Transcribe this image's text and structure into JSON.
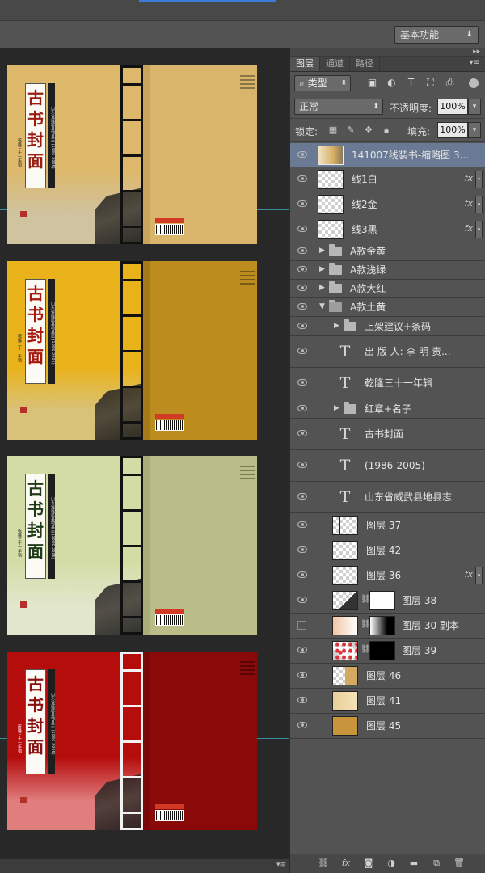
{
  "optionsbar": {
    "workspace": "基本功能"
  },
  "panel": {
    "tabs": [
      "图层",
      "通道",
      "路径"
    ],
    "filter": {
      "label": "类型"
    },
    "blend": {
      "mode": "正常",
      "opacity_label": "不透明度:",
      "opacity": "100%"
    },
    "lock": {
      "label": "锁定:",
      "fill_label": "填充:",
      "fill": "100%"
    },
    "filter_icons": [
      "image-filter-icon",
      "adjustment-filter-icon",
      "type-filter-icon",
      "shape-filter-icon",
      "smart-object-filter-icon"
    ],
    "bottom_icons": [
      "link-layers-icon",
      "fx-icon",
      "add-mask-icon",
      "adjustment-layer-icon",
      "new-group-icon",
      "new-layer-icon",
      "trash-icon"
    ]
  },
  "layers": [
    {
      "name": "141007线装书-缩略图 3...",
      "kind": "smart",
      "selected": true,
      "visible": true,
      "indent": 0,
      "height": 30
    },
    {
      "name": "线1白",
      "kind": "pixel",
      "fx": true,
      "visible": true,
      "indent": 0,
      "height": 31
    },
    {
      "name": "线2金",
      "kind": "pixel",
      "fx": true,
      "visible": true,
      "indent": 0,
      "height": 31
    },
    {
      "name": "线3黑",
      "kind": "pixel",
      "fx": true,
      "visible": true,
      "indent": 0,
      "height": 31
    },
    {
      "name": "A款金黄",
      "kind": "group",
      "open": false,
      "visible": true,
      "indent": 0,
      "height": 23
    },
    {
      "name": "A款浅绿",
      "kind": "group",
      "open": false,
      "visible": true,
      "indent": 0,
      "height": 23
    },
    {
      "name": "A款大红",
      "kind": "group",
      "open": false,
      "visible": true,
      "indent": 0,
      "height": 23
    },
    {
      "name": "A款土黄",
      "kind": "group",
      "open": true,
      "visible": true,
      "indent": 0,
      "height": 23
    },
    {
      "name": "上架建议+条码",
      "kind": "group",
      "open": false,
      "visible": true,
      "indent": 1,
      "height": 24
    },
    {
      "name": "出 版 人: 李 明 责...",
      "kind": "text",
      "visible": true,
      "indent": 1,
      "height": 39
    },
    {
      "name": "乾隆三十一年辑",
      "kind": "text",
      "visible": true,
      "indent": 1,
      "height": 39
    },
    {
      "name": "红章+名子",
      "kind": "group",
      "open": false,
      "visible": true,
      "indent": 1,
      "height": 24
    },
    {
      "name": "古书封面",
      "kind": "text",
      "visible": true,
      "indent": 1,
      "height": 39
    },
    {
      "name": "(1986-2005)",
      "kind": "text",
      "visible": true,
      "indent": 1,
      "height": 39
    },
    {
      "name": "山东省威武县地县志",
      "kind": "text",
      "visible": true,
      "indent": 1,
      "height": 39
    },
    {
      "name": "图层 37",
      "kind": "pixel",
      "thumb": "line",
      "visible": true,
      "indent": 1,
      "height": 31
    },
    {
      "name": "图层 42",
      "kind": "pixel",
      "thumb": "empty",
      "visible": true,
      "indent": 1,
      "height": 31
    },
    {
      "name": "图层 36",
      "kind": "pixel",
      "thumb": "empty",
      "fx": true,
      "visible": true,
      "indent": 1,
      "height": 31
    },
    {
      "name": "图层 38",
      "kind": "masked",
      "thumb": "building",
      "mask": "white",
      "visible": true,
      "indent": 1,
      "height": 31
    },
    {
      "name": "图层 30 副本",
      "kind": "masked",
      "thumb": "peach",
      "mask": "fade",
      "visible": false,
      "indent": 1,
      "height": 31
    },
    {
      "name": "图层 39",
      "kind": "masked",
      "thumb": "red-dots",
      "mask": "black",
      "visible": true,
      "indent": 1,
      "height": 31
    },
    {
      "name": "图层 46",
      "kind": "pixel",
      "thumb": "tan-half",
      "visible": true,
      "indent": 1,
      "height": 31
    },
    {
      "name": "图层 41",
      "kind": "pixel",
      "thumb": "tan-pattern",
      "visible": true,
      "indent": 1,
      "height": 31
    },
    {
      "name": "图层 45",
      "kind": "pixel",
      "thumb": "tan-solid",
      "visible": true,
      "indent": 1,
      "height": 31
    }
  ],
  "covers": [
    {
      "name": "earth-yellow",
      "title": [
        "古",
        "书",
        "封",
        "面"
      ],
      "title_color": "#9a1c12",
      "back_bg": "#ddb86a",
      "front_bg": "#d9b56c",
      "spine_bg": "#c9a45c",
      "line_color": "#111111",
      "haze": "#cfc3a0"
    },
    {
      "name": "golden-yellow",
      "title": [
        "古",
        "书",
        "封",
        "面"
      ],
      "title_color": "#a8180e",
      "back_bg": "#eab21a",
      "front_bg": "#bd8c1e",
      "spine_bg": "#a67a18",
      "line_color": "#111111",
      "haze": "#d8c27a"
    },
    {
      "name": "light-green",
      "title": [
        "古",
        "书",
        "封",
        "面"
      ],
      "title_color": "#1f3a16",
      "back_bg": "#d4dca6",
      "front_bg": "#bbbd88",
      "spine_bg": "#aaae7a",
      "line_color": "#111111",
      "haze": "#e2e6cc"
    },
    {
      "name": "big-red",
      "title": [
        "古",
        "书",
        "封",
        "面"
      ],
      "title_color": "#8a1010",
      "back_bg": "#b50c0c",
      "front_bg": "#8a0909",
      "spine_bg": "#7a0808",
      "line_color": "#f2f2f2",
      "haze": "#e07d7d"
    }
  ],
  "cover_subtitle": "山东省威武县地县志",
  "cover_years": "(1986-2005)",
  "cover_note": "乾隆三十一年辑",
  "colors": {
    "panel_bg": "#535353",
    "selected_row": "#6b7a94",
    "guide": "#3fb9c9"
  }
}
